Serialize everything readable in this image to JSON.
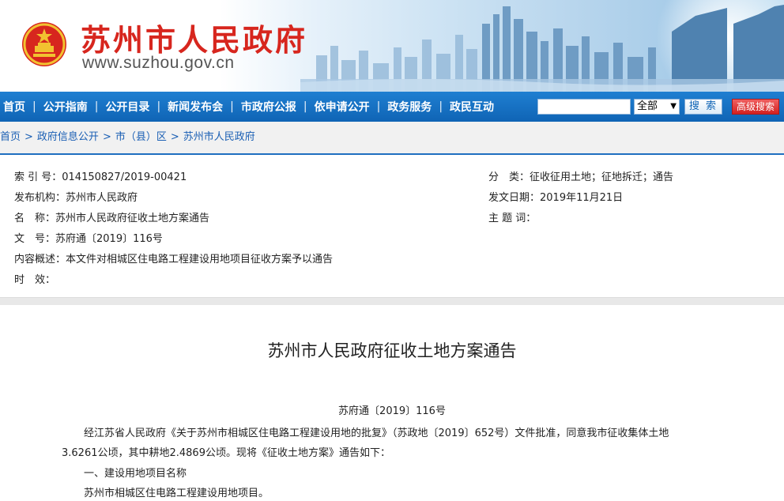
{
  "header": {
    "site_title": "苏州市人民政府",
    "site_url": "www.suzhou.gov.cn",
    "title_color": "#d7261e"
  },
  "nav": {
    "items": [
      "首页",
      "公开指南",
      "公开目录",
      "新闻发布会",
      "市政府公报",
      "依申请公开",
      "政务服务",
      "政民互动"
    ],
    "separator": "|",
    "search": {
      "value": "",
      "scope": "全部",
      "caret": "▼",
      "search_label": "搜 索",
      "advanced_label": "高级搜索"
    },
    "bar_color": "#1373c6"
  },
  "breadcrumb": {
    "items": [
      "首页",
      "政府信息公开",
      "市（县）区",
      "苏州市人民政府"
    ],
    "separator": ">"
  },
  "meta": {
    "index_no": "索 引 号：014150827/2019-00421",
    "publisher": "发布机构：苏州市人民政府",
    "name": "名　称：苏州市人民政府征收土地方案通告",
    "doc_no": "文　号：苏府通〔2019〕116号",
    "summary": "内容概述：本文件对相城区住电路工程建设用地项目征收方案予以通告",
    "validity": "时　效：",
    "category": "分　类：征收征用土地；征地拆迁；通告",
    "date": "发文日期：2019年11月21日",
    "keywords": "主 题 词："
  },
  "article": {
    "title": "苏州市人民政府征收土地方案通告",
    "doc_number": "苏府通〔2019〕116号",
    "para1_line1": "经江苏省人民政府《关于苏州市相城区住电路工程建设用地的批复》（苏政地〔2019〕652号）文件批准，同意我市征收集体土地",
    "para1_line2": "3.6261公顷，其中耕地2.4869公顷。现将《征收土地方案》通告如下：",
    "section1": "一、建设用地项目名称",
    "section1_content": "苏州市相城区住电路工程建设用地项目。"
  }
}
